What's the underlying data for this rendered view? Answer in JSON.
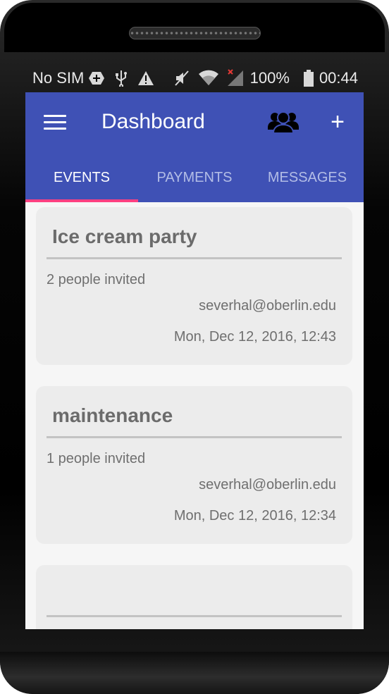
{
  "status_bar": {
    "carrier": "No SIM",
    "battery": "100%",
    "time": "00:44",
    "icons": [
      "sim-add-icon",
      "usb-icon",
      "warning-icon",
      "mute-icon",
      "wifi-icon",
      "signal-icon",
      "battery-icon"
    ]
  },
  "app_bar": {
    "title": "Dashboard",
    "menu_icon": "hamburger-menu-icon",
    "group_icon": "group-icon",
    "add_label": "+"
  },
  "tabs": [
    {
      "label": "EVENTS",
      "active": true
    },
    {
      "label": "PAYMENTS",
      "active": false
    },
    {
      "label": "MESSAGES",
      "active": false
    }
  ],
  "events": [
    {
      "title": "Ice cream party",
      "invited": "2 people invited",
      "email": "severhal@oberlin.edu",
      "date": "Mon, Dec 12, 2016, 12:43"
    },
    {
      "title": "maintenance",
      "invited": "1 people invited",
      "email": "severhal@oberlin.edu",
      "date": "Mon, Dec 12, 2016, 12:34"
    },
    {
      "title": "",
      "invited": "",
      "email": "",
      "date": ""
    }
  ],
  "colors": {
    "primary": "#3f51b5",
    "accent": "#ff4081",
    "card_bg": "#ececec",
    "screen_bg": "#f6f6f6"
  }
}
